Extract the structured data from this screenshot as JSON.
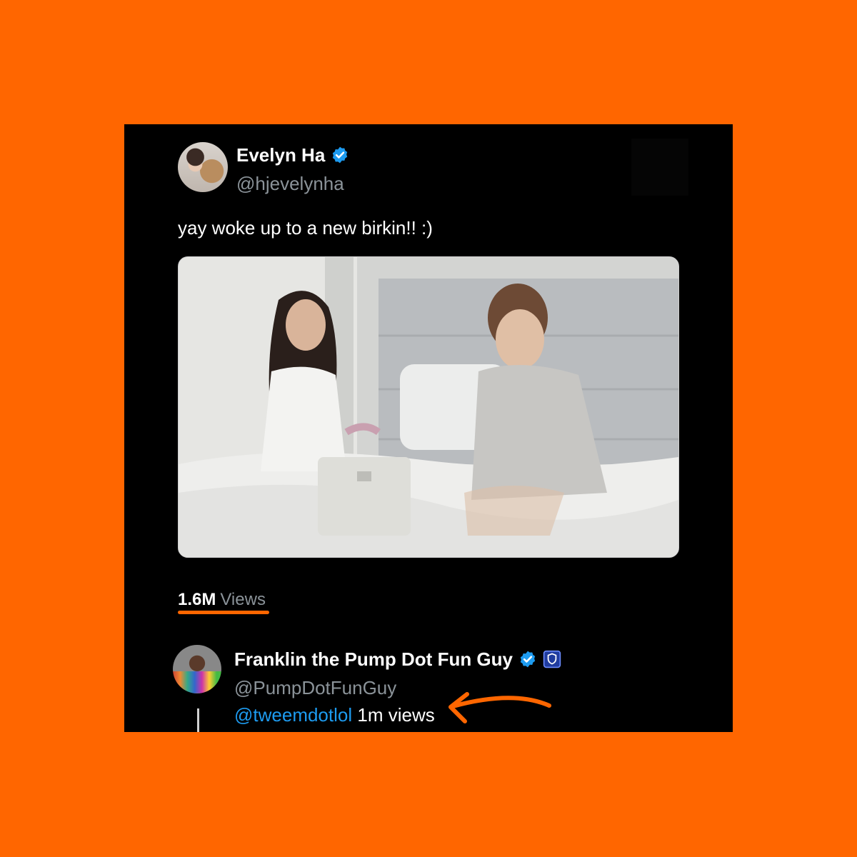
{
  "colors": {
    "background": "#ff6600",
    "panel": "#000000",
    "accent": "#ff6600",
    "link": "#1d9bf0",
    "verified": "#1d9bf0",
    "muted": "#8b9399"
  },
  "tweet": {
    "author": {
      "name": "Evelyn Ha",
      "handle": "@hjevelynha",
      "verified": true,
      "avatar_icon": "profile-photo"
    },
    "text": "yay woke up to a new birkin!! :)",
    "media_icon": "photo",
    "views_count": "1.6M",
    "views_label": "Views"
  },
  "reply": {
    "author": {
      "name": "Franklin the Pump Dot Fun Guy",
      "handle": "@PumpDotFunGuy",
      "verified": true,
      "affiliate_badge_icon": "shield-badge-icon",
      "avatar_icon": "profile-photo"
    },
    "mention": "@tweemdotlol",
    "text": "1m views"
  },
  "annotations": {
    "arrow_icon": "curved-arrow-left-icon"
  }
}
